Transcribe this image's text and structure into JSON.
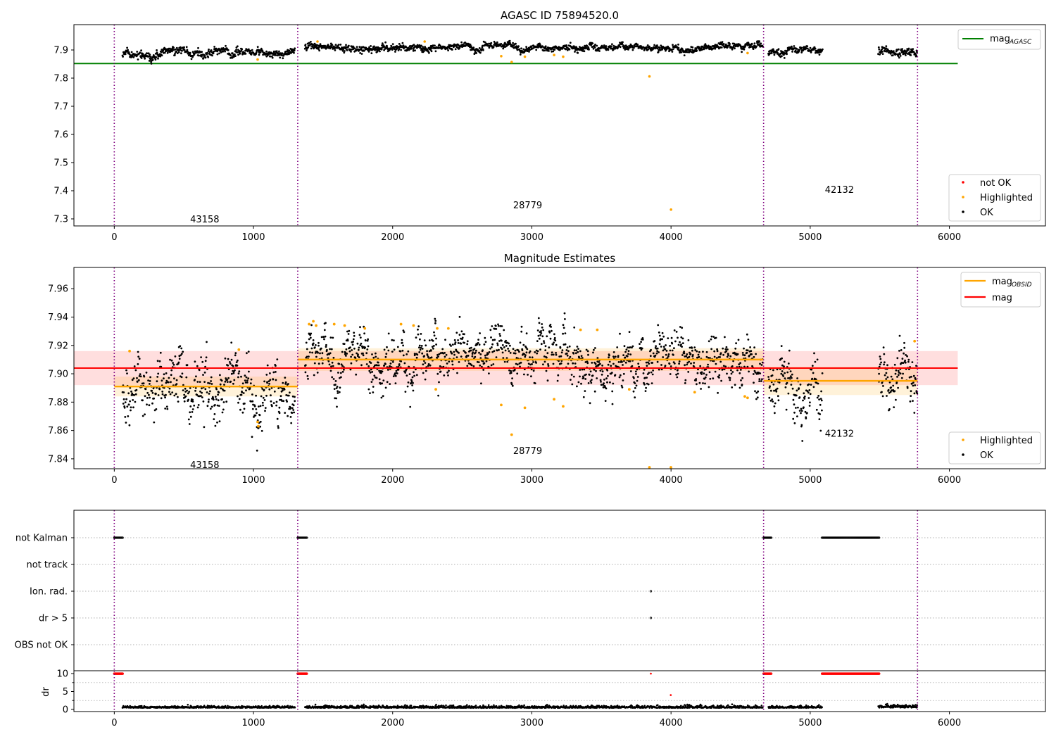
{
  "colors": {
    "ok": "#000000",
    "highlighted": "#ffa500",
    "not_ok": "#ff0000",
    "mag_agasc": "#008000",
    "mag_obsid": "#ffa500",
    "mag": "#ff0000",
    "obsid_divider": "#800080",
    "grid": "#b0b0b0"
  },
  "chart_data": [
    {
      "type": "scatter",
      "title": "AGASC ID 75894520.0",
      "xlim": [
        -290,
        6690
      ],
      "ylim": [
        7.275,
        7.99
      ],
      "xticks": [
        0,
        1000,
        2000,
        3000,
        4000,
        5000,
        6000
      ],
      "yticks": [
        7.3,
        7.4,
        7.5,
        7.6,
        7.7,
        7.8,
        7.9
      ],
      "obsid_boundaries": [
        0,
        1318,
        4665,
        5771
      ],
      "obsid_labels": [
        {
          "text": "43158",
          "x": 650,
          "y": 7.3
        },
        {
          "text": "28779",
          "x": 2970,
          "y": 7.35
        },
        {
          "text": "42132",
          "x": 5210,
          "y": 7.405
        }
      ],
      "mag_agasc": {
        "value": 7.852,
        "x_range": [
          -290,
          6060
        ]
      },
      "ok_segments": [
        {
          "x_start": 60,
          "x_end": 1300,
          "mean": 7.889,
          "spread": 0.008
        },
        {
          "x_start": 1370,
          "x_end": 4660,
          "mean": 7.909,
          "spread": 0.007
        },
        {
          "x_start": 4700,
          "x_end": 5090,
          "mean": 7.895,
          "spread": 0.007
        },
        {
          "x_start": 5490,
          "x_end": 5770,
          "mean": 7.897,
          "spread": 0.008
        }
      ],
      "highlighted_points": [
        {
          "x": 1030,
          "y": 7.866
        },
        {
          "x": 2780,
          "y": 7.878
        },
        {
          "x": 2855,
          "y": 7.857
        },
        {
          "x": 2950,
          "y": 7.876
        },
        {
          "x": 3160,
          "y": 7.882
        },
        {
          "x": 3225,
          "y": 7.876
        },
        {
          "x": 3845,
          "y": 7.806
        },
        {
          "x": 4000,
          "y": 7.333
        },
        {
          "x": 1460,
          "y": 7.93
        },
        {
          "x": 2230,
          "y": 7.93
        },
        {
          "x": 4550,
          "y": 7.889
        }
      ],
      "legend_lines": [
        {
          "label": "mag",
          "sub": "AGASC",
          "color_key": "mag_agasc"
        }
      ],
      "legend_markers": [
        {
          "label": "not OK",
          "color_key": "not_ok"
        },
        {
          "label": "Highlighted",
          "color_key": "highlighted"
        },
        {
          "label": "OK",
          "color_key": "ok"
        }
      ]
    },
    {
      "type": "scatter",
      "title": "Magnitude Estimates",
      "xlim": [
        -290,
        6690
      ],
      "ylim": [
        7.833,
        7.975
      ],
      "xticks": [
        0,
        1000,
        2000,
        3000,
        4000,
        5000,
        6000
      ],
      "yticks": [
        7.84,
        7.86,
        7.88,
        7.9,
        7.92,
        7.94,
        7.96
      ],
      "obsid_boundaries": [
        0,
        1318,
        4665,
        5771
      ],
      "obsid_labels": [
        {
          "text": "43158",
          "x": 650,
          "y": 7.836
        },
        {
          "text": "28779",
          "x": 2970,
          "y": 7.846
        },
        {
          "text": "42132",
          "x": 5210,
          "y": 7.858
        }
      ],
      "mag": {
        "value": 7.904,
        "band": [
          7.892,
          7.916
        ],
        "x_range": [
          -290,
          6060
        ]
      },
      "mag_obsid": [
        {
          "x_range": [
            0,
            1318
          ],
          "value": 7.891,
          "band": [
            7.884,
            7.898
          ]
        },
        {
          "x_range": [
            1318,
            4665
          ],
          "value": 7.91,
          "band": [
            7.902,
            7.918
          ]
        },
        {
          "x_range": [
            4665,
            5771
          ],
          "value": 7.895,
          "band": [
            7.885,
            7.905
          ]
        }
      ],
      "ok_segments": [
        {
          "x_start": 60,
          "x_end": 1300,
          "mean": 7.891,
          "spread": 0.012
        },
        {
          "x_start": 1370,
          "x_end": 4660,
          "mean": 7.909,
          "spread": 0.01
        },
        {
          "x_start": 4700,
          "x_end": 5090,
          "mean": 7.896,
          "spread": 0.011
        },
        {
          "x_start": 5490,
          "x_end": 5770,
          "mean": 7.895,
          "spread": 0.01
        }
      ],
      "highlighted_points": [
        {
          "x": 110,
          "y": 7.916
        },
        {
          "x": 895,
          "y": 7.917
        },
        {
          "x": 1030,
          "y": 7.866
        },
        {
          "x": 1035,
          "y": 7.863
        },
        {
          "x": 1400,
          "y": 7.935
        },
        {
          "x": 1430,
          "y": 7.937
        },
        {
          "x": 1450,
          "y": 7.934
        },
        {
          "x": 1580,
          "y": 7.935
        },
        {
          "x": 1655,
          "y": 7.934
        },
        {
          "x": 1800,
          "y": 7.932
        },
        {
          "x": 2060,
          "y": 7.935
        },
        {
          "x": 2150,
          "y": 7.934
        },
        {
          "x": 2310,
          "y": 7.889
        },
        {
          "x": 2320,
          "y": 7.932
        },
        {
          "x": 2400,
          "y": 7.932
        },
        {
          "x": 2780,
          "y": 7.878
        },
        {
          "x": 2855,
          "y": 7.857
        },
        {
          "x": 2950,
          "y": 7.876
        },
        {
          "x": 3160,
          "y": 7.882
        },
        {
          "x": 3225,
          "y": 7.877
        },
        {
          "x": 3350,
          "y": 7.931
        },
        {
          "x": 3470,
          "y": 7.931
        },
        {
          "x": 3700,
          "y": 7.889
        },
        {
          "x": 3845,
          "y": 7.834
        },
        {
          "x": 3999,
          "y": 7.834
        },
        {
          "x": 4170,
          "y": 7.887
        },
        {
          "x": 4530,
          "y": 7.884
        },
        {
          "x": 4550,
          "y": 7.883
        },
        {
          "x": 5750,
          "y": 7.923
        }
      ],
      "legend_lines": [
        {
          "label": "mag",
          "sub": "OBSID",
          "color_key": "mag_obsid"
        },
        {
          "label": "mag",
          "sub": "",
          "color_key": "mag"
        }
      ],
      "legend_markers": [
        {
          "label": "Highlighted",
          "color_key": "highlighted"
        },
        {
          "label": "OK",
          "color_key": "ok"
        }
      ]
    },
    {
      "type": "scatter",
      "title": "",
      "xlim": [
        -290,
        6690
      ],
      "categories": [
        "not Kalman",
        "not track",
        "Ion. rad.",
        "dr > 5",
        "OBS not OK"
      ],
      "obsid_boundaries": [
        0,
        1318,
        4665,
        5771
      ],
      "flag_runs": [
        {
          "category": "not Kalman",
          "x_start": 0,
          "x_end": 60
        },
        {
          "category": "not Kalman",
          "x_start": 1318,
          "x_end": 1385
        },
        {
          "category": "not Kalman",
          "x_start": 4665,
          "x_end": 4720
        },
        {
          "category": "not Kalman",
          "x_start": 5085,
          "x_end": 5495
        }
      ],
      "flag_points": [
        {
          "category": "Ion. rad.",
          "x": 3855
        },
        {
          "category": "dr > 5",
          "x": 3855
        }
      ]
    },
    {
      "type": "scatter",
      "title": "",
      "ylabel": "dr",
      "xlim": [
        -290,
        6690
      ],
      "ylim": [
        -0.6,
        10.8
      ],
      "xticks": [
        0,
        1000,
        2000,
        3000,
        4000,
        5000,
        6000
      ],
      "yticks": [
        0,
        5,
        10
      ],
      "obsid_boundaries": [
        0,
        1318,
        4665,
        5771
      ],
      "ok_segments": [
        {
          "x_start": 60,
          "x_end": 1300,
          "mean": 0.5,
          "spread": 0.25
        },
        {
          "x_start": 1370,
          "x_end": 4660,
          "mean": 0.5,
          "spread": 0.3
        },
        {
          "x_start": 4700,
          "x_end": 5085,
          "mean": 0.5,
          "spread": 0.25
        },
        {
          "x_start": 5490,
          "x_end": 5770,
          "mean": 0.6,
          "spread": 0.35
        }
      ],
      "not_ok_runs": [
        {
          "x_start": 0,
          "x_end": 60,
          "value": 10
        },
        {
          "x_start": 1318,
          "x_end": 1385,
          "value": 10
        },
        {
          "x_start": 4665,
          "x_end": 4720,
          "value": 10
        },
        {
          "x_start": 5085,
          "x_end": 5495,
          "value": 10
        }
      ],
      "not_ok_points": [
        {
          "x": 3855,
          "y": 10
        },
        {
          "x": 3998,
          "y": 4
        }
      ]
    }
  ]
}
